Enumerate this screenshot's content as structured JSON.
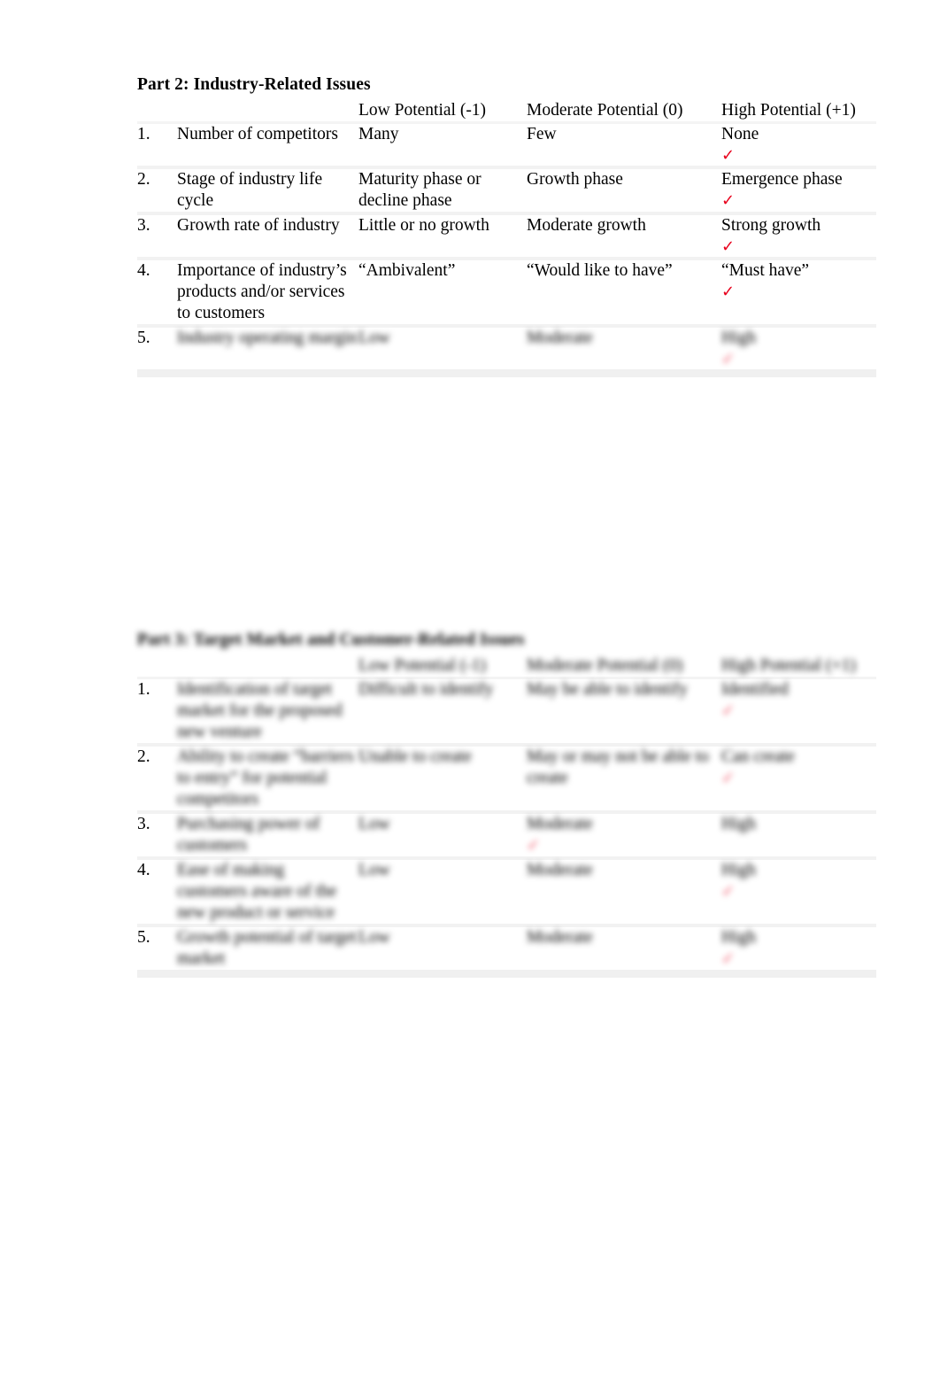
{
  "page": {
    "background": "#ffffff",
    "check_color": "#e8001c",
    "check_glyph": "✓"
  },
  "table1": {
    "title": "Part 2: Industry-Related Issues",
    "columns": {
      "item": "",
      "low": "Low Potential (-1)",
      "moderate": "Moderate Potential (0)",
      "high": "High Potential (+1)"
    },
    "rows": [
      {
        "num": "1.",
        "item": "Number of competitors",
        "low": "Many",
        "moderate": "Few",
        "high": "None",
        "checked": "high",
        "blur": "none"
      },
      {
        "num": "2.",
        "item": "Stage of industry life cycle",
        "low": "Maturity phase or decline phase",
        "moderate": "Growth phase",
        "high": "Emergence phase",
        "checked": "high",
        "blur": "none"
      },
      {
        "num": "3.",
        "item": "Growth rate of industry",
        "low": "Little or no growth",
        "moderate": "Moderate growth",
        "high": "Strong growth",
        "checked": "high",
        "blur": "none"
      },
      {
        "num": "4.",
        "item": "Importance of industry’s products and/or services to customers",
        "low": "“Ambivalent”",
        "moderate": "“Would like to have”",
        "high": "“Must have”",
        "checked": "high",
        "blur": "none"
      },
      {
        "num": "5.",
        "item": "Industry operating margin",
        "low": "Low",
        "moderate": "Moderate",
        "high": "High",
        "checked": "high",
        "blur": "heavy"
      }
    ]
  },
  "table2": {
    "title": "Part 3: Target Market and Customer-Related Issues",
    "columns": {
      "item": "",
      "low": "Low Potential (-1)",
      "moderate": "Moderate Potential (0)",
      "high": "High Potential (+1)"
    },
    "rows": [
      {
        "num": "1.",
        "item": "Identification of target market for the proposed new venture",
        "low": "Difficult to identify",
        "moderate": "May be able to identify",
        "high": "Identified",
        "checked": "high",
        "blur": "heavy"
      },
      {
        "num": "2.",
        "item": "Ability to create “barriers to entry” for potential competitors",
        "low": "Unable to create",
        "moderate": "May or may not be able to create",
        "high": "Can create",
        "checked": "high",
        "blur": "heavy"
      },
      {
        "num": "3.",
        "item": "Purchasing power of customers",
        "low": "Low",
        "moderate": "Moderate",
        "high": "High",
        "checked": "moderate",
        "blur": "heavy"
      },
      {
        "num": "4.",
        "item": "Ease of making customers aware of the new product or service",
        "low": "Low",
        "moderate": "Moderate",
        "high": "High",
        "checked": "high",
        "blur": "heavy"
      },
      {
        "num": "5.",
        "item": "Growth potential of target market",
        "low": "Low",
        "moderate": "Moderate",
        "high": "High",
        "checked": "high",
        "blur": "heavy"
      }
    ]
  }
}
